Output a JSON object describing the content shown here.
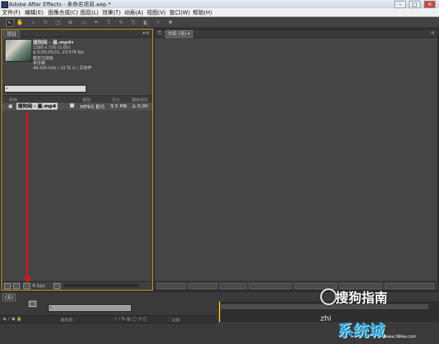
{
  "window": {
    "title": "Adobe After Effects - 未命名项目.aep *"
  },
  "menu": [
    "文件(F)",
    "编辑(E)",
    "图像合成(C)",
    "图层(L)",
    "效果(T)",
    "动画(A)",
    "视图(V)",
    "窗口(W)",
    "帮助(H)"
  ],
  "project_panel": {
    "tab": "项目",
    "file_name": "搜狗网 - 最.mp4▾",
    "meta": [
      "1280 x 720 (1.00)",
      "Δ 0;00;30;01, 23.976 fps",
      "数百万颜色",
      "非压缩",
      "48.000 kHz / 32 位 U / 立体声"
    ],
    "columns": [
      "名称",
      "类型",
      "大小",
      "媒体时长"
    ],
    "row": {
      "name": "搜狗网 - 最.mp4",
      "type": "MPEG 影片",
      "size": "9.5 MB",
      "duration": "Δ 0;00"
    },
    "bpc": "8 bpc"
  },
  "comp_panel": {
    "dropdown": "合成: (无)"
  },
  "timeline": {
    "tab": "(无)",
    "layer_columns": [
      "源名称",
      "父级"
    ]
  },
  "watermarks": {
    "sogou": "搜狗指南",
    "zhi": "zhi",
    "site": "系统城",
    "site_url": "www.386w.com"
  }
}
